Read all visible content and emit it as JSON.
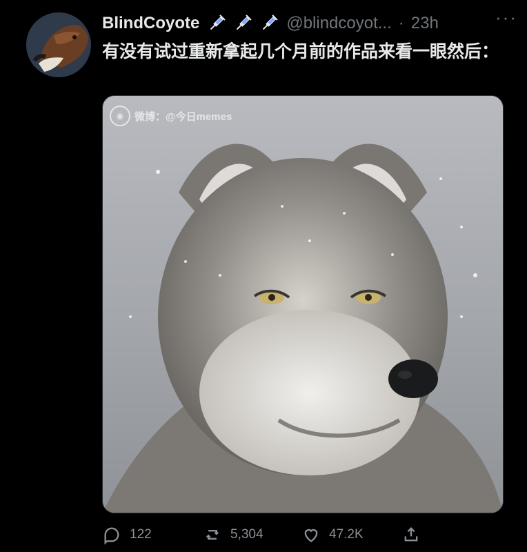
{
  "tweet": {
    "display_name": "BlindCoyote",
    "badges": [
      "syringe-icon",
      "syringe-icon",
      "syringe-icon"
    ],
    "handle": "@blindcoyot...",
    "separator": "·",
    "time": "23h",
    "more": "···",
    "text": "有没有试过重新拿起几个月前的作品来看一眼然后：",
    "media": {
      "watermark": "微博：@今日memes"
    },
    "actions": {
      "reply_count": "122",
      "retweet_count": "5,304",
      "like_count": "47.2K"
    }
  },
  "colors": {
    "background": "#000000",
    "text": "#e7e9ea",
    "muted": "#71767b"
  }
}
